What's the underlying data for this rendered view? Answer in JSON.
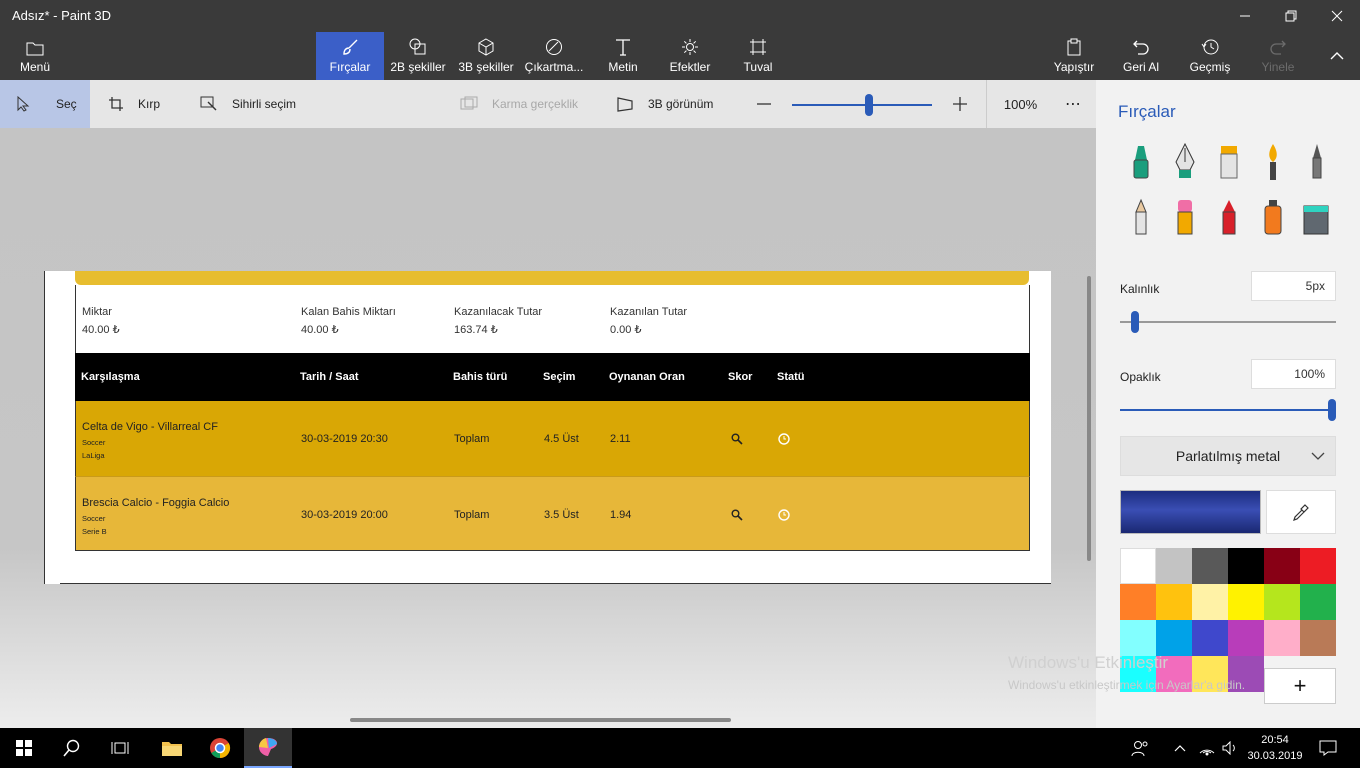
{
  "window": {
    "title": "Adsız* - Paint 3D"
  },
  "ribbon": {
    "menu": "Menü",
    "brushes": "Fırçalar",
    "shapes2d": "2B şekiller",
    "shapes3d": "3B şekiller",
    "stickers": "Çıkartma...",
    "text": "Metin",
    "effects": "Efektler",
    "canvas": "Tuval",
    "paste": "Yapıştır",
    "undo": "Geri Al",
    "history": "Geçmiş",
    "redo": "Yinele"
  },
  "toolbar": {
    "select": "Seç",
    "crop": "Kırp",
    "magic": "Sihirli seçim",
    "mixed": "Karma gerçeklik",
    "view3d": "3B görünüm",
    "zoom": "100%",
    "zoom_level": 0.55
  },
  "doc": {
    "summary": [
      {
        "label": "Miktar",
        "value": "40.00 ₺"
      },
      {
        "label": "Kalan Bahis Miktarı",
        "value": "40.00 ₺"
      },
      {
        "label": "Kazanılacak Tutar",
        "value": "163.74 ₺"
      },
      {
        "label": "Kazanılan Tutar",
        "value": "0.00 ₺"
      }
    ],
    "headers": [
      "Karşılaşma",
      "Tarih / Saat",
      "Bahis türü",
      "Seçim",
      "Oynanan Oran",
      "Skor",
      "Statü"
    ],
    "rows": [
      {
        "match": "Celta de Vigo - Villarreal CF",
        "sport": "Soccer",
        "league": "LaLiga",
        "date": "30-03-2019 20:30",
        "type": "Toplam",
        "pick": "4.5 Üst",
        "odds": "2.11",
        "bg": "#d9a705"
      },
      {
        "match": "Brescia Calcio - Foggia Calcio",
        "sport": "Soccer",
        "league": "Serie B",
        "date": "30-03-2019 20:00",
        "type": "Toplam",
        "pick": "3.5 Üst",
        "odds": "1.94",
        "bg": "#e7b739"
      }
    ]
  },
  "panel": {
    "title": "Fırçalar",
    "thickness_label": "Kalınlık",
    "thickness_value": "5px",
    "thickness_level": 0.05,
    "opacity_label": "Opaklık",
    "opacity_value": "100%",
    "opacity_level": 1.0,
    "material": "Parlatılmış metal",
    "colors": [
      "#ffffff",
      "#c3c3c3",
      "#595959",
      "#000000",
      "#880015",
      "#ed1c24",
      "#ff7f27",
      "#ffc20e",
      "#fff2a6",
      "#fff200",
      "#b5e61d",
      "#22b14c",
      "#82ffff",
      "#00a2e8",
      "#3f48cc",
      "#b83dba",
      "#ffaec9",
      "#b97a57",
      "#1affff",
      "#f26cbd",
      "#ffe65a",
      "#9c4bb5"
    ]
  },
  "watermark": {
    "line1": "Windows'u Etkinleştir",
    "line2": "Windows'u etkinleştirmek için Ayarlar'a gidin."
  },
  "taskbar": {
    "time": "20:54",
    "date": "30.03.2019"
  }
}
